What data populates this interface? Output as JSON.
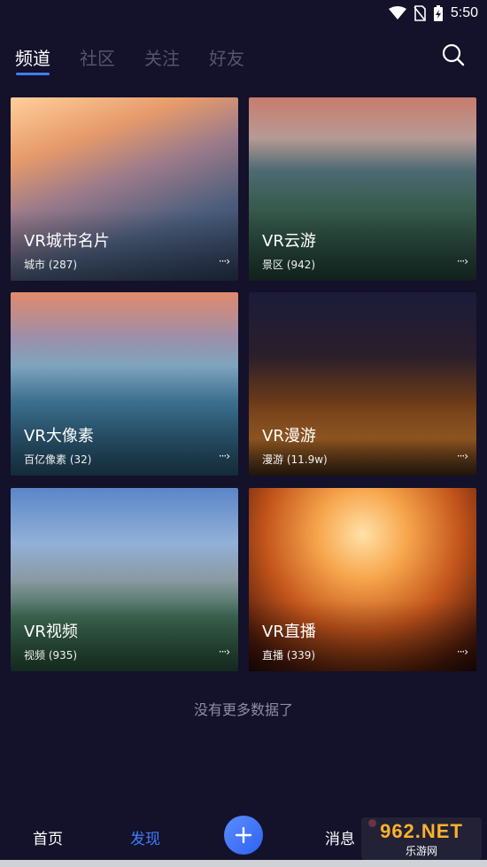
{
  "status_bar": {
    "time": "5:50"
  },
  "tabs": [
    {
      "label": "频道",
      "active": true
    },
    {
      "label": "社区",
      "active": false
    },
    {
      "label": "关注",
      "active": false
    },
    {
      "label": "好友",
      "active": false
    }
  ],
  "channels": [
    {
      "title": "VR城市名片",
      "sub": "城市 (287)",
      "more": "···›"
    },
    {
      "title": "VR云游",
      "sub": "景区 (942)",
      "more": "···›"
    },
    {
      "title": "VR大像素",
      "sub": "百亿像素 (32)",
      "more": "···›"
    },
    {
      "title": "VR漫游",
      "sub": "漫游 (11.9w)",
      "more": "···›"
    },
    {
      "title": "VR视频",
      "sub": "视频 (935)",
      "more": "···›"
    },
    {
      "title": "VR直播",
      "sub": "直播 (339)",
      "more": "···›"
    }
  ],
  "footer_text": "没有更多数据了",
  "bottom_nav": {
    "home": "首页",
    "discover": "发现",
    "messages": "消息"
  },
  "watermark": {
    "top": "962.NET",
    "bottom": "乐游网"
  },
  "colors": {
    "accent": "#3f7dff",
    "background": "#14112a"
  }
}
